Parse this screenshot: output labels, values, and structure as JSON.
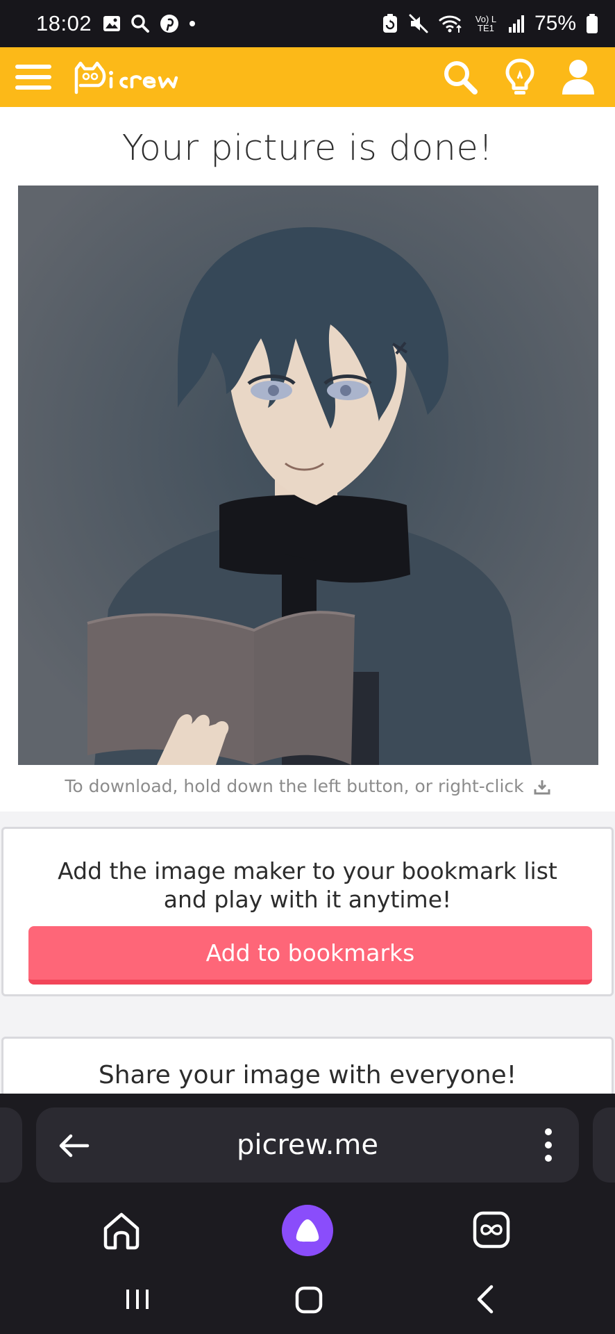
{
  "status_bar": {
    "time": "18:02",
    "battery": "75%",
    "network": "Vo) LTE1",
    "left_icons": [
      "gallery-icon",
      "search-icon",
      "pinterest-icon",
      "dot-icon"
    ],
    "right_icons": [
      "battery-saver-icon",
      "mute-icon",
      "wifi-icon",
      "volte-icon",
      "signal-icon",
      "battery-icon"
    ]
  },
  "header": {
    "logo_text": "Picrew",
    "actions": [
      "search-icon",
      "lightbulb-icon",
      "user-icon"
    ],
    "brand_color": "#fcb918"
  },
  "result": {
    "title": "Your picture is done!",
    "download_hint": "To download, hold down the left button, or right-click"
  },
  "bookmark": {
    "message": "Add the image maker to your bookmark list and play with it anytime!",
    "button_label": "Add to bookmarks",
    "button_color": "#fe6678"
  },
  "share": {
    "message": "Share your image with everyone!"
  },
  "browser": {
    "url": "picrew.me",
    "nav_icons": [
      "home-icon",
      "alice-icon",
      "tabs-icon"
    ],
    "alice_color": "#8a4dfb"
  },
  "system_nav": [
    "recents-icon",
    "home-icon",
    "back-icon"
  ]
}
